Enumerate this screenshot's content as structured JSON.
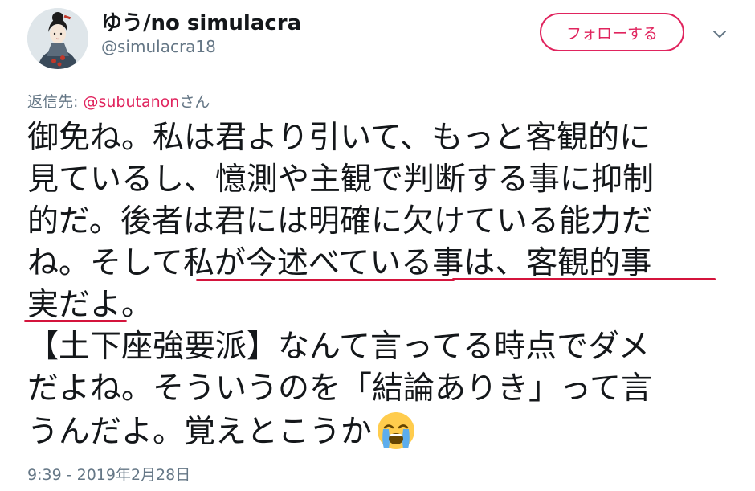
{
  "author": {
    "display_name": "ゆう/no simulacra",
    "handle": "@simulacra18"
  },
  "follow_button": {
    "label": "フォローする"
  },
  "reply": {
    "prefix": "返信先: ",
    "mention": "@subutanon",
    "suffix": "さん"
  },
  "tweet": {
    "lines": [
      "御免ね。私は君より引いて、もっと客観的に",
      "見ているし、憶測や主観で判断する事に抑制",
      "的だ。後者は君には明確に欠けている能力だ",
      "ね。そして私が今述べている事は、客観的事",
      "実だよ。",
      "【土下座強要派】なんて言ってる時点でダメ",
      "だよね。そういうのを「結論ありき」って言",
      "うんだよ。覚えとこうか"
    ],
    "emoji": "loudly-crying-face"
  },
  "timestamp": "9:39 - 2019年2月28日",
  "colors": {
    "accent": "#e0245e",
    "underline": "#d4143c",
    "secondary_text": "#657786"
  }
}
